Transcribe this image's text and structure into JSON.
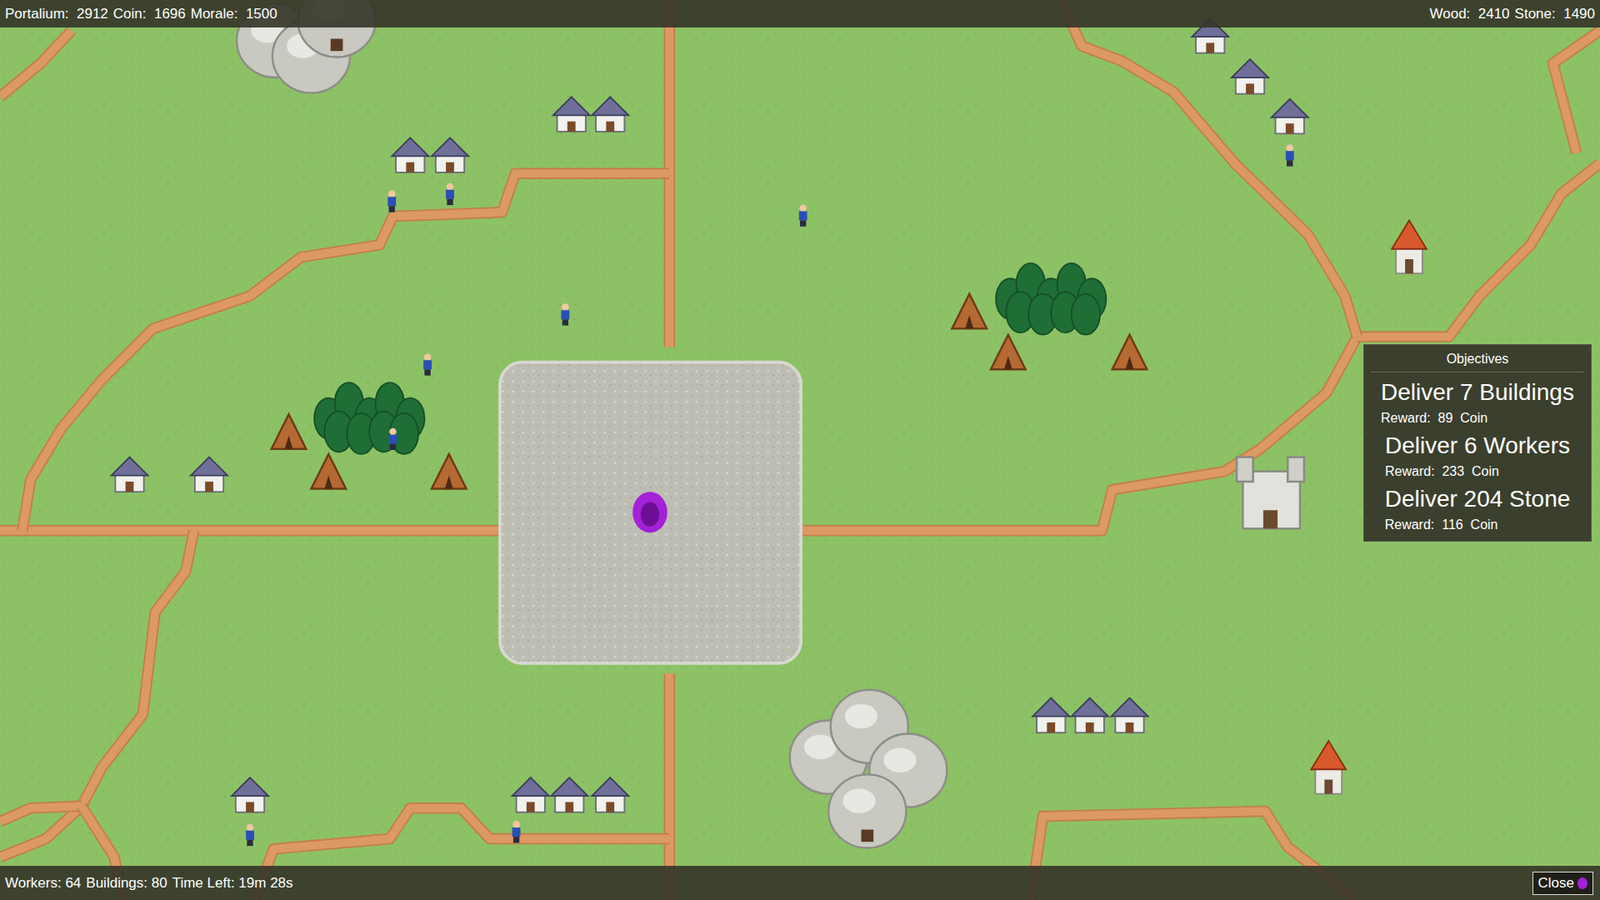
{
  "top_bar": {
    "left": [
      {
        "label": "Portalium:",
        "value": "2912"
      },
      {
        "label": "Coin:",
        "value": "1696"
      },
      {
        "label": "Morale:",
        "value": "1500"
      }
    ],
    "right": [
      {
        "label": "Wood:",
        "value": "2410"
      },
      {
        "label": "Stone:",
        "value": "1490"
      }
    ]
  },
  "objectives": {
    "title": "Objectives",
    "items": [
      {
        "goal": "Deliver 7 Buildings",
        "reward_label": "Reward:",
        "reward": "89",
        "unit": "Coin"
      },
      {
        "goal": "Deliver 6 Workers",
        "reward_label": "Reward:",
        "reward": "233",
        "unit": "Coin"
      },
      {
        "goal": "Deliver 204 Stone",
        "reward_label": "Reward:",
        "reward": "116",
        "unit": "Coin"
      }
    ]
  },
  "status_bar": [
    {
      "label": "Workers:",
      "value": "64"
    },
    {
      "label": "Buildings:",
      "value": "80"
    },
    {
      "label": "Time Left:",
      "value": "19m 28s"
    }
  ],
  "close_button": {
    "label": "Close"
  }
}
